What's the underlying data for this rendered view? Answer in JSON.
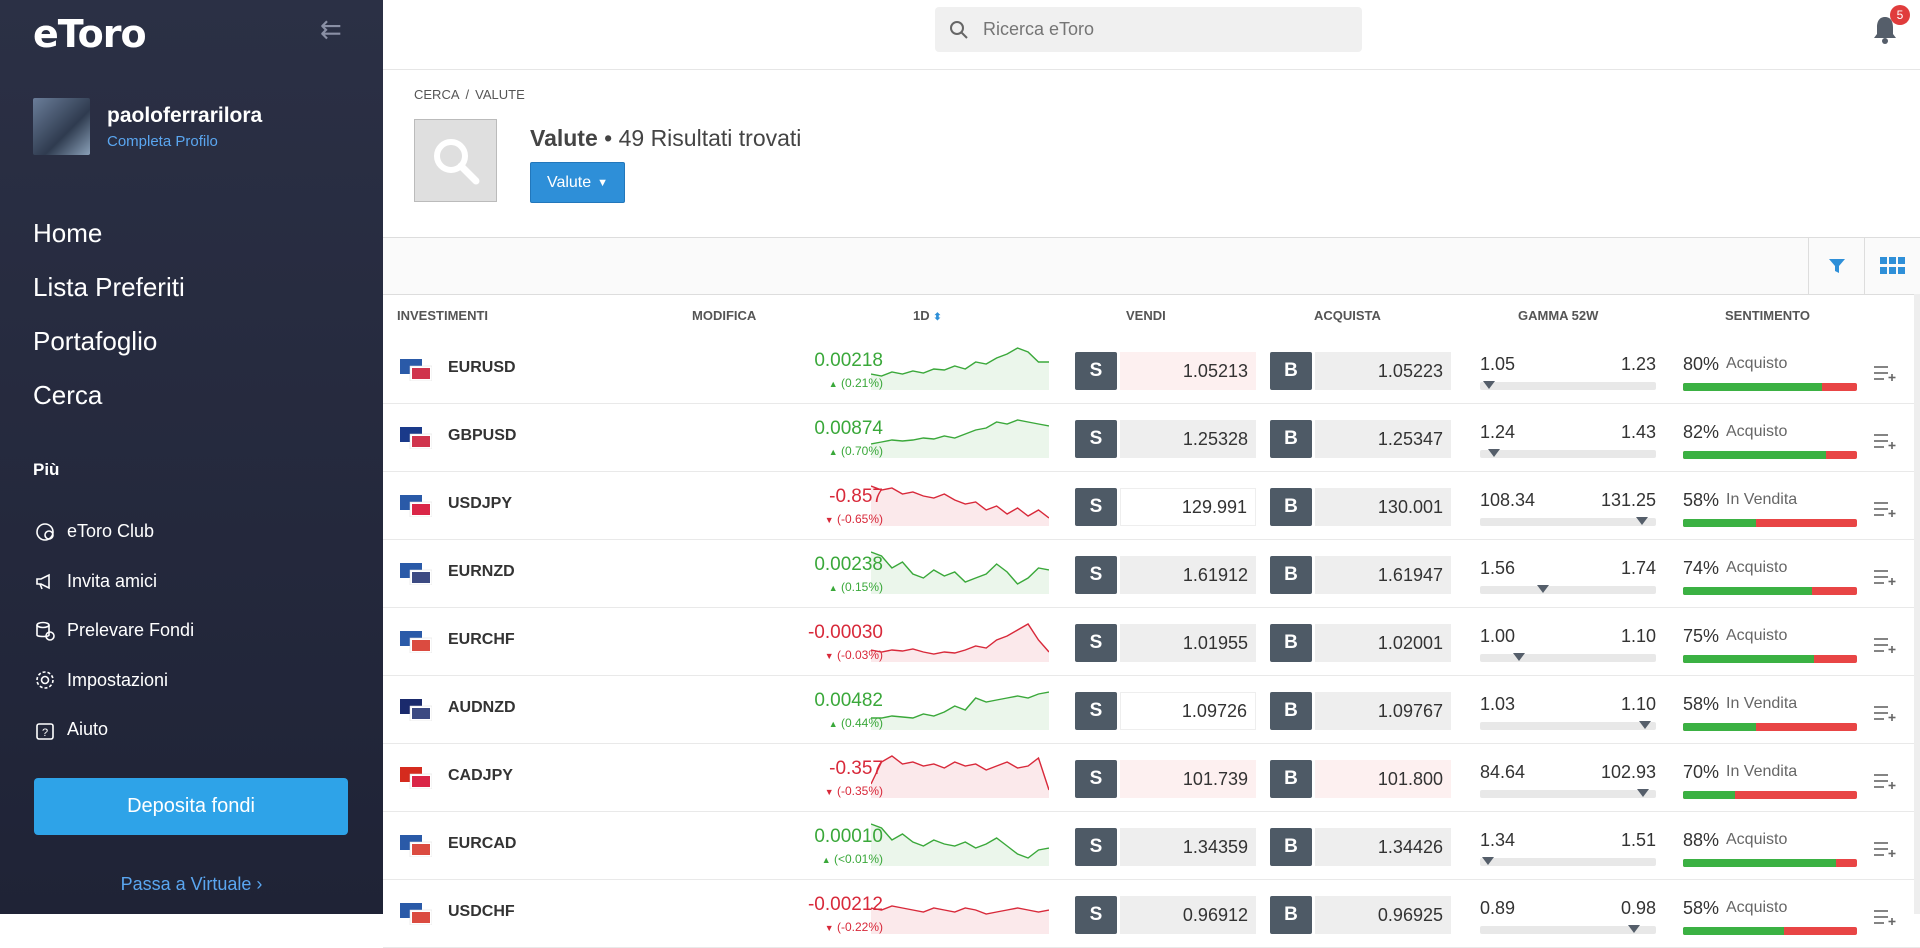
{
  "sidebar": {
    "logo": "eToro",
    "username": "paoloferrarilora",
    "profile_link": "Completa Profilo",
    "main_nav": [
      "Home",
      "Lista Preferiti",
      "Portafoglio",
      "Cerca"
    ],
    "more_label": "Più",
    "sub_nav": [
      {
        "label": "eToro Club",
        "icon": "club-icon"
      },
      {
        "label": "Invita amici",
        "icon": "megaphone-icon"
      },
      {
        "label": "Prelevare Fondi",
        "icon": "coins-icon"
      },
      {
        "label": "Impostazioni",
        "icon": "gear-icon"
      },
      {
        "label": "Aiuto",
        "icon": "help-icon"
      }
    ],
    "deposit_label": "Deposita fondi",
    "virtual_label": "Passa a Virtuale ›"
  },
  "header": {
    "search_placeholder": "Ricerca eToro",
    "notifications": "5"
  },
  "page": {
    "breadcrumb": [
      "CERCA",
      "VALUTE"
    ],
    "title": "Valute",
    "results": "• 49 Risultati trovati",
    "dropdown_label": "Valute"
  },
  "table": {
    "columns": [
      "INVESTIMENTI",
      "MODIFICA",
      "1D",
      "VENDI",
      "ACQUISTA",
      "GAMMA 52W",
      "SENTIMENTO"
    ],
    "rows": [
      {
        "symbol": "EURUSD",
        "change": "0.00218",
        "pct": "(0.21%)",
        "dir": "up",
        "sell": "1.05213",
        "buy": "1.05223",
        "lo": "1.05",
        "hi": "1.23",
        "range_pos": 0.02,
        "sent": "80%",
        "sent_label": "Acquisto",
        "sent_val": 80,
        "spark": [
          30,
          32,
          28,
          30,
          27,
          29,
          25,
          26,
          22,
          25,
          18,
          20,
          14,
          10,
          4,
          8,
          18,
          18
        ],
        "sell_hl": true,
        "buy_hl": false
      },
      {
        "symbol": "GBPUSD",
        "change": "0.00874",
        "pct": "(0.70%)",
        "dir": "up",
        "sell": "1.25328",
        "buy": "1.25347",
        "lo": "1.24",
        "hi": "1.43",
        "range_pos": 0.05,
        "sent": "82%",
        "sent_label": "Acquisto",
        "sent_val": 82,
        "spark": [
          32,
          30,
          28,
          29,
          28,
          26,
          27,
          24,
          26,
          22,
          18,
          16,
          10,
          12,
          8,
          10,
          12,
          14
        ],
        "sell_hl": false,
        "buy_hl": false
      },
      {
        "symbol": "USDJPY",
        "change": "-0.857",
        "pct": "(-0.65%)",
        "dir": "down",
        "sell": "129.991",
        "buy": "130.001",
        "lo": "108.34",
        "hi": "131.25",
        "range_pos": 0.95,
        "sent": "58%",
        "sent_label": "In Vendita",
        "sent_val": 42,
        "spark": [
          6,
          10,
          8,
          14,
          12,
          16,
          18,
          14,
          20,
          24,
          22,
          30,
          26,
          34,
          28,
          36,
          30,
          38
        ],
        "sell_hl": false,
        "buy_hl": false,
        "sell_white": true
      },
      {
        "symbol": "EURNZD",
        "change": "0.00238",
        "pct": "(0.15%)",
        "dir": "up",
        "sell": "1.61912",
        "buy": "1.61947",
        "lo": "1.56",
        "hi": "1.74",
        "range_pos": 0.35,
        "sent": "74%",
        "sent_label": "Acquisto",
        "sent_val": 74,
        "spark": [
          4,
          8,
          20,
          14,
          26,
          30,
          22,
          28,
          24,
          34,
          30,
          26,
          16,
          24,
          36,
          30,
          20,
          22
        ],
        "sell_hl": false,
        "buy_hl": false
      },
      {
        "symbol": "EURCHF",
        "change": "-0.00030",
        "pct": "(-0.03%)",
        "dir": "down",
        "sell": "1.01955",
        "buy": "1.02001",
        "lo": "1.00",
        "hi": "1.10",
        "range_pos": 0.2,
        "sent": "75%",
        "sent_label": "Acquisto",
        "sent_val": 75,
        "spark": [
          34,
          36,
          34,
          35,
          33,
          36,
          38,
          36,
          37,
          34,
          30,
          32,
          24,
          20,
          14,
          8,
          24,
          36
        ],
        "sell_hl": false,
        "buy_hl": false
      },
      {
        "symbol": "AUDNZD",
        "change": "0.00482",
        "pct": "(0.44%)",
        "dir": "up",
        "sell": "1.09726",
        "buy": "1.09767",
        "lo": "1.03",
        "hi": "1.10",
        "range_pos": 0.97,
        "sent": "58%",
        "sent_label": "In Vendita",
        "sent_val": 42,
        "spark": [
          34,
          34,
          32,
          33,
          34,
          30,
          32,
          28,
          22,
          26,
          14,
          18,
          16,
          14,
          12,
          14,
          10,
          8
        ],
        "sell_hl": false,
        "buy_hl": false,
        "sell_white": true
      },
      {
        "symbol": "CADJPY",
        "change": "-0.357",
        "pct": "(-0.35%)",
        "dir": "down",
        "sell": "101.739",
        "buy": "101.800",
        "lo": "84.64",
        "hi": "102.93",
        "range_pos": 0.96,
        "sent": "70%",
        "sent_label": "In Vendita",
        "sent_val": 30,
        "spark": [
          32,
          10,
          4,
          12,
          10,
          14,
          12,
          16,
          10,
          14,
          12,
          18,
          14,
          10,
          16,
          14,
          6,
          38
        ],
        "sell_hl": true,
        "buy_hl": true
      },
      {
        "symbol": "EURCAD",
        "change": "0.00010",
        "pct": "(<0.01%)",
        "dir": "up",
        "sell": "1.34359",
        "buy": "1.34426",
        "lo": "1.34",
        "hi": "1.51",
        "range_pos": 0.01,
        "sent": "88%",
        "sent_label": "Acquisto",
        "sent_val": 88,
        "spark": [
          4,
          8,
          20,
          14,
          22,
          26,
          20,
          24,
          26,
          22,
          28,
          24,
          18,
          26,
          34,
          38,
          30,
          28
        ],
        "sell_hl": false,
        "buy_hl": false
      },
      {
        "symbol": "USDCHF",
        "change": "-0.00212",
        "pct": "(-0.22%)",
        "dir": "down",
        "sell": "0.96912",
        "buy": "0.96925",
        "lo": "0.89",
        "hi": "0.98",
        "range_pos": 0.9,
        "sent": "58%",
        "sent_label": "Acquisto",
        "sent_val": 58,
        "spark": [
          20,
          22,
          18,
          20,
          22,
          24,
          20,
          22,
          24,
          20,
          22,
          26,
          24,
          22,
          20,
          22,
          24,
          22
        ],
        "sell_hl": false,
        "buy_hl": false
      }
    ],
    "flags": {
      "EURUSD": [
        "#2a5aa8",
        "#c8102e"
      ],
      "GBPUSD": [
        "#1a3a8a",
        "#c8102e"
      ],
      "USDJPY": [
        "#2a5aa8",
        "#d40027"
      ],
      "EURNZD": [
        "#2a5aa8",
        "#1a2a6c"
      ],
      "EURCHF": [
        "#2a5aa8",
        "#d52b1e"
      ],
      "AUDNZD": [
        "#1a2a6c",
        "#1a2a6c"
      ],
      "CADJPY": [
        "#d52b1e",
        "#d40027"
      ],
      "EURCAD": [
        "#2a5aa8",
        "#d52b1e"
      ],
      "USDCHF": [
        "#2a5aa8",
        "#d52b1e"
      ]
    }
  },
  "colors": {
    "up": "#3aa83a",
    "down": "#d8293a",
    "accent": "#2ea3e8"
  }
}
